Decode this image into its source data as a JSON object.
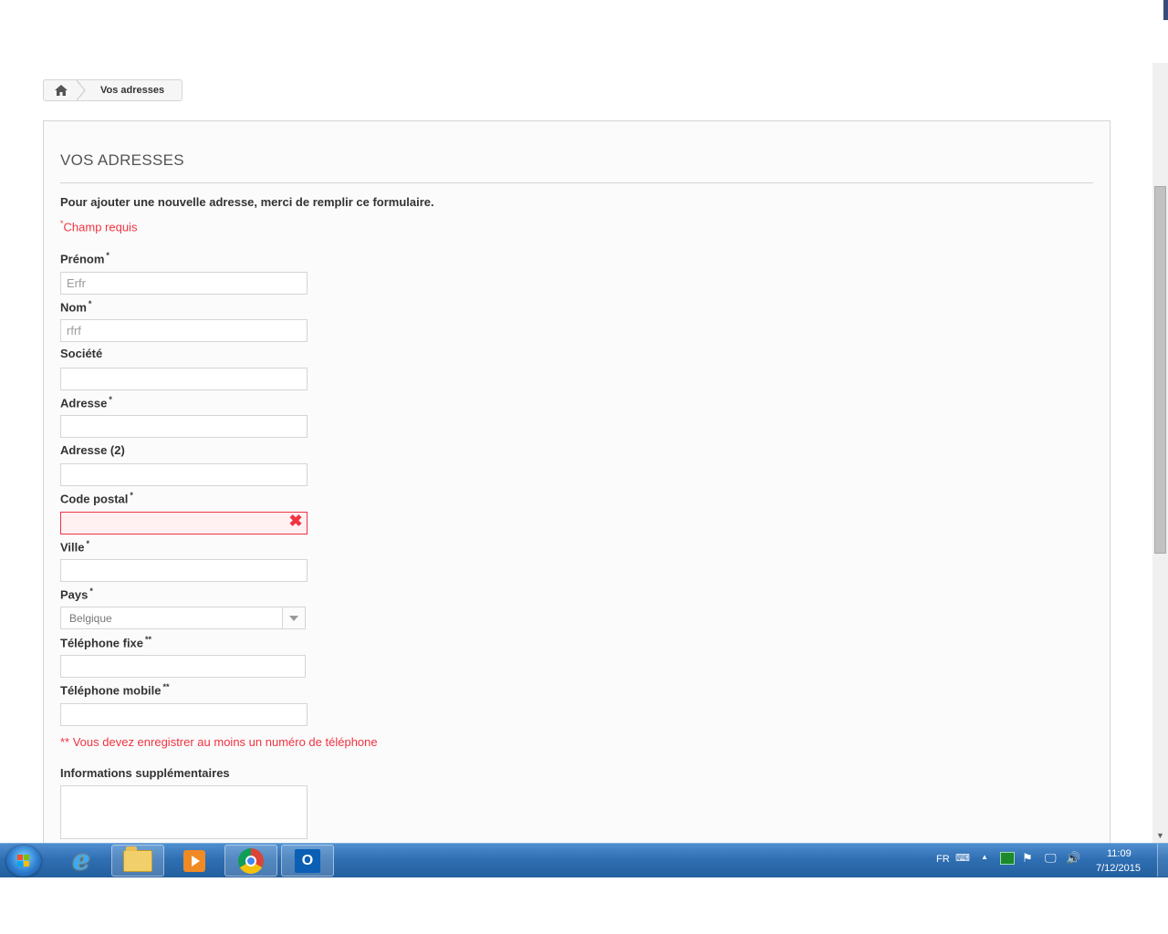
{
  "breadcrumb": {
    "home_icon": "home-icon",
    "current": "Vos adresses"
  },
  "page": {
    "title": "Vos adresses",
    "intro": "Pour ajouter une nouvelle adresse, merci de remplir ce formulaire.",
    "required_star": "*",
    "required_note": "Champ requis"
  },
  "form": {
    "firstname": {
      "label": "Prénom",
      "mark": "*",
      "value": "Erfr"
    },
    "lastname": {
      "label": "Nom",
      "mark": "*",
      "value": "rfrf"
    },
    "company": {
      "label": "Société",
      "value": ""
    },
    "address1": {
      "label": "Adresse",
      "mark": "*",
      "value": ""
    },
    "address2": {
      "label": "Adresse (2)",
      "value": ""
    },
    "postcode": {
      "label": "Code postal",
      "mark": "*",
      "value": "",
      "error_icon": "✖"
    },
    "city": {
      "label": "Ville",
      "mark": "*",
      "value": ""
    },
    "country": {
      "label": "Pays",
      "mark": "*",
      "selected": "Belgique"
    },
    "phone": {
      "label": "Téléphone fixe",
      "mark": "**",
      "value": ""
    },
    "mobile": {
      "label": "Téléphone mobile",
      "mark": "**",
      "value": ""
    },
    "phone_note": "** Vous devez enregistrer au moins un numéro de téléphone",
    "other": {
      "label": "Informations supplémentaires",
      "value": ""
    }
  },
  "taskbar": {
    "apps": [
      "start-orb",
      "internet-explorer",
      "file-explorer",
      "media-player",
      "chrome",
      "outlook"
    ],
    "language": "FR",
    "time": "11:09",
    "date": "7/12/2015"
  },
  "colors": {
    "error": "#f13340",
    "border": "#d6d4d4",
    "panel_bg": "#fbfbfb"
  }
}
